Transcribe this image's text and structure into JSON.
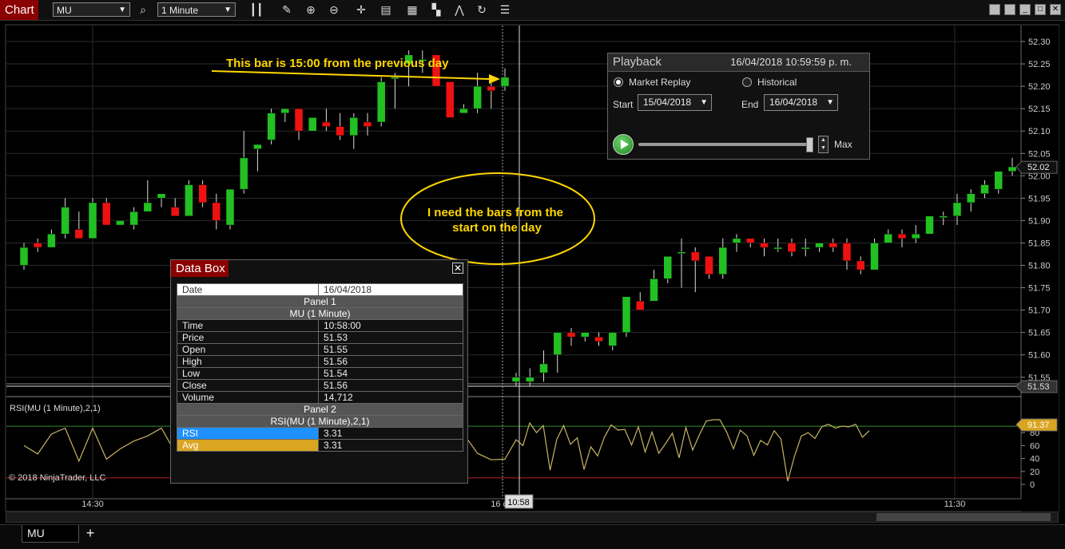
{
  "toolbar": {
    "chart_tab": "Chart",
    "instrument": "MU",
    "interval": "1 Minute",
    "icons": [
      "search-icon",
      "bar-type-icon",
      "draw-tool-icon",
      "zoom-in-icon",
      "zoom-out-icon",
      "crosshair-icon",
      "data-box-icon",
      "order-icon",
      "strategy-icon",
      "indicator-icon",
      "refresh-icon",
      "properties-icon"
    ],
    "window_buttons": [
      "",
      "",
      "",
      "✕"
    ]
  },
  "annotations": {
    "arrow_text": "This bar is 15:00 from the previous day",
    "ellipse_line1": "I need the bars from the",
    "ellipse_line2": "start on the day"
  },
  "playback": {
    "title": "Playback",
    "datetime": "16/04/2018 10:59:59 p. m.",
    "market_replay": "Market Replay",
    "historical": "Historical",
    "start_label": "Start",
    "start_value": "15/04/2018",
    "end_label": "End",
    "end_value": "16/04/2018",
    "speed_label": "Max",
    "slider_position": 1.0
  },
  "databox": {
    "title": "Data Box",
    "close": "✕",
    "date_label": "Date",
    "date_value": "16/04/2018",
    "panel1": "Panel 1",
    "series1": "MU (1 Minute)",
    "rows": [
      {
        "k": "Time",
        "v": "10:58:00"
      },
      {
        "k": "Price",
        "v": "51.53"
      },
      {
        "k": "Open",
        "v": "51.55"
      },
      {
        "k": "High",
        "v": "51.56"
      },
      {
        "k": "Low",
        "v": "51.54"
      },
      {
        "k": "Close",
        "v": "51.56"
      },
      {
        "k": "Volume",
        "v": "14,712"
      }
    ],
    "panel2": "Panel 2",
    "series2": "RSI(MU (1 Minute),2,1)",
    "rsi_label": "RSI",
    "rsi_value": "3.31",
    "avg_label": "Avg",
    "avg_value": "3.31"
  },
  "chart": {
    "rsi_label": "RSI(MU (1 Minute),2,1)",
    "copyright": "© 2018 NinjaTrader, LLC",
    "price_ticks": [
      "52.30",
      "52.25",
      "52.20",
      "52.15",
      "52.10",
      "52.05",
      "52.00",
      "51.95",
      "51.90",
      "51.85",
      "51.80",
      "51.75",
      "51.70",
      "51.65",
      "51.60",
      "51.55"
    ],
    "rsi_ticks": [
      "80",
      "60",
      "40",
      "20",
      "0"
    ],
    "time_ticks": [
      "14:30",
      "16 d",
      "11:30"
    ],
    "cursor_time": "10:58",
    "last_price": "52.02",
    "cursor_price": "51.53",
    "rsi_last": "91.37"
  },
  "colors": {
    "up": "#22c022",
    "down": "#ee1111",
    "annotation": "#ffd700",
    "rsi_line": "#c8b464"
  },
  "chart_data": {
    "type": "candlestick",
    "series": [
      {
        "name": "MU (1 Minute)",
        "candles": [
          [
            51.8,
            51.85,
            51.79,
            51.84
          ],
          [
            51.85,
            51.86,
            51.83,
            51.84
          ],
          [
            51.84,
            51.88,
            51.84,
            51.87
          ],
          [
            51.87,
            51.95,
            51.86,
            51.93
          ],
          [
            51.88,
            51.92,
            51.86,
            51.86
          ],
          [
            51.86,
            51.95,
            51.86,
            51.94
          ],
          [
            51.94,
            51.95,
            51.89,
            51.89
          ],
          [
            51.89,
            51.9,
            51.89,
            51.9
          ],
          [
            51.89,
            51.93,
            51.88,
            51.92
          ],
          [
            51.92,
            51.99,
            51.92,
            51.94
          ],
          [
            51.95,
            51.96,
            51.93,
            51.96
          ],
          [
            51.93,
            51.95,
            51.91,
            51.91
          ],
          [
            51.91,
            51.99,
            51.91,
            51.98
          ],
          [
            51.98,
            51.99,
            51.93,
            51.94
          ],
          [
            51.94,
            51.96,
            51.88,
            51.9
          ],
          [
            51.89,
            51.97,
            51.88,
            51.97
          ],
          [
            51.97,
            52.1,
            51.96,
            52.04
          ],
          [
            52.06,
            52.07,
            52.01,
            52.07
          ],
          [
            52.08,
            52.15,
            52.07,
            52.14
          ],
          [
            52.14,
            52.15,
            52.12,
            52.15
          ],
          [
            52.15,
            52.15,
            52.08,
            52.1
          ],
          [
            52.1,
            52.13,
            52.11,
            52.13
          ],
          [
            52.12,
            52.15,
            52.1,
            52.11
          ],
          [
            52.11,
            52.14,
            52.08,
            52.09
          ],
          [
            52.09,
            52.14,
            52.06,
            52.13
          ],
          [
            52.12,
            52.14,
            52.09,
            52.11
          ],
          [
            52.12,
            52.22,
            52.11,
            52.21
          ],
          [
            52.22,
            52.23,
            52.15,
            52.22
          ],
          [
            52.25,
            52.28,
            52.2,
            52.27
          ],
          [
            52.26,
            52.28,
            52.23,
            52.26
          ],
          [
            52.27,
            52.27,
            52.2,
            52.2
          ],
          [
            52.21,
            52.21,
            52.13,
            52.13
          ],
          [
            52.14,
            52.16,
            52.14,
            52.15
          ],
          [
            52.15,
            52.23,
            52.14,
            52.2
          ],
          [
            52.2,
            52.21,
            52.15,
            52.19
          ],
          [
            52.2,
            52.24,
            52.19,
            52.22
          ],
          [
            51.54,
            51.56,
            51.53,
            51.55
          ],
          [
            51.54,
            51.57,
            51.53,
            51.55
          ],
          [
            51.56,
            51.61,
            51.54,
            51.58
          ],
          [
            51.6,
            51.64,
            51.56,
            51.65
          ],
          [
            51.65,
            51.66,
            51.62,
            51.64
          ],
          [
            51.64,
            51.65,
            51.63,
            51.65
          ],
          [
            51.64,
            51.65,
            51.62,
            51.63
          ],
          [
            51.62,
            51.65,
            51.61,
            51.65
          ],
          [
            51.65,
            51.73,
            51.64,
            51.73
          ],
          [
            51.72,
            51.74,
            51.7,
            51.7
          ],
          [
            51.72,
            51.79,
            51.72,
            51.77
          ],
          [
            51.77,
            51.82,
            51.76,
            51.82
          ],
          [
            51.83,
            51.86,
            51.75,
            51.83
          ],
          [
            51.83,
            51.84,
            51.74,
            51.81
          ],
          [
            51.82,
            51.82,
            51.77,
            51.78
          ],
          [
            51.78,
            51.86,
            51.77,
            51.84
          ],
          [
            51.85,
            51.87,
            51.83,
            51.86
          ],
          [
            51.86,
            51.86,
            51.84,
            51.85
          ],
          [
            51.85,
            51.86,
            51.82,
            51.84
          ],
          [
            51.84,
            51.86,
            51.83,
            51.84
          ],
          [
            51.85,
            51.86,
            51.82,
            51.83
          ],
          [
            51.84,
            51.86,
            51.82,
            51.84
          ],
          [
            51.84,
            51.85,
            51.83,
            51.85
          ],
          [
            51.85,
            51.86,
            51.83,
            51.84
          ],
          [
            51.85,
            51.86,
            51.79,
            51.81
          ],
          [
            51.81,
            51.82,
            51.78,
            51.79
          ],
          [
            51.79,
            51.86,
            51.79,
            51.85
          ],
          [
            51.85,
            51.88,
            51.85,
            51.87
          ],
          [
            51.87,
            51.88,
            51.84,
            51.86
          ],
          [
            51.86,
            51.89,
            51.85,
            51.87
          ],
          [
            51.87,
            51.91,
            51.87,
            51.91
          ],
          [
            51.91,
            51.92,
            51.89,
            51.91
          ],
          [
            51.91,
            51.96,
            51.89,
            51.94
          ],
          [
            51.94,
            51.97,
            51.92,
            51.96
          ],
          [
            51.96,
            51.99,
            51.95,
            51.98
          ],
          [
            51.97,
            52.01,
            51.96,
            52.01
          ],
          [
            52.01,
            52.04,
            52.0,
            52.02
          ]
        ]
      },
      {
        "name": "RSI(MU (1 Minute),2,1)",
        "values": [
          60,
          47,
          78,
          87,
          36,
          87,
          39,
          55,
          67,
          75,
          87,
          50,
          23,
          55,
          77,
          80,
          86,
          89,
          68,
          92,
          56,
          39,
          28,
          34,
          80,
          62,
          22,
          75,
          85,
          65,
          48,
          12,
          78,
          48,
          38,
          39,
          69,
          60,
          95,
          80,
          91,
          22,
          70,
          91,
          62,
          72,
          23,
          58,
          44,
          73,
          92,
          84,
          85,
          61,
          89,
          50,
          81,
          48,
          63,
          79,
          41,
          88,
          53,
          77,
          98,
          100,
          100,
          81,
          55,
          84,
          75,
          45,
          68,
          61,
          83,
          70,
          5,
          44,
          75,
          80,
          71,
          89,
          93,
          87,
          90,
          89,
          93,
          73,
          83
        ]
      }
    ],
    "ylim_price": [
      51.525,
      52.32
    ],
    "ylim_rsi": [
      0,
      100
    ],
    "xlabels": [
      "14:30",
      "16 d",
      "11:30"
    ]
  }
}
